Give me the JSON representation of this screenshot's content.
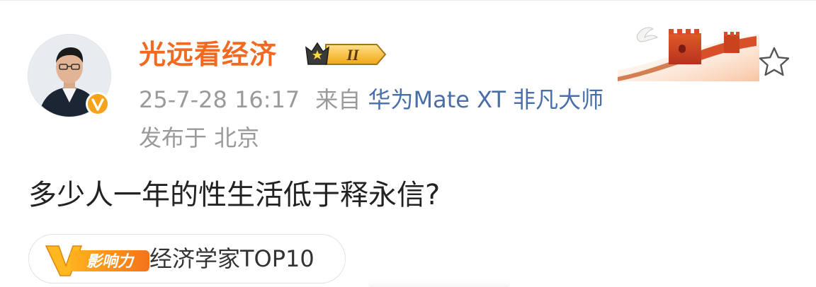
{
  "user": {
    "name": "光远看经济",
    "level_roman": "II"
  },
  "meta": {
    "timestamp": "25-7-28 16:17",
    "source_prefix": "来自",
    "source_device": "华为Mate XT 非凡大师",
    "location": "发布于 北京"
  },
  "post": {
    "text": "多少人一年的性生活低于释永信?"
  },
  "influence": {
    "logo_text": "影响力",
    "label": "经济学家TOP10"
  },
  "colors": {
    "username": "#f26a22",
    "meta": "#9a9a9a",
    "source_link": "#4a6ea8",
    "badge_orange": "#f7a21b"
  },
  "icons": {
    "avatar": "avatar",
    "verified": "verified-v-icon",
    "level": "crown-level-icon",
    "decoration": "great-wall-decoration",
    "favorite": "star-icon"
  }
}
